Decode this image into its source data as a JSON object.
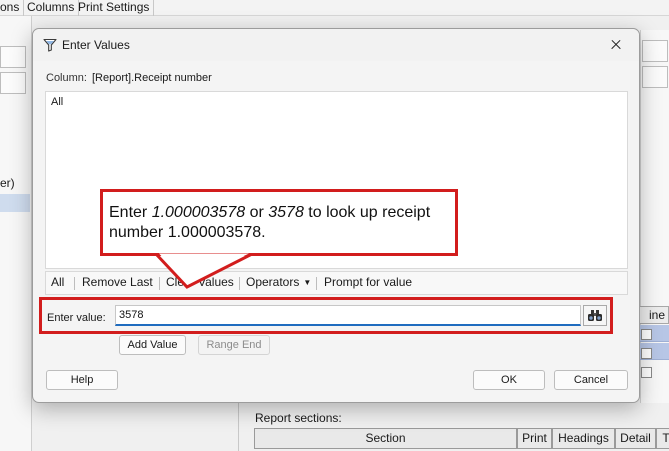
{
  "background": {
    "menu": [
      "ons",
      "Columns",
      "Print Settings"
    ],
    "left_panel_text": "er)",
    "line_header": "ine",
    "report_sections_label": "Report sections:",
    "table_headers": [
      "Section",
      "Print",
      "Headings",
      "Detail",
      "T"
    ]
  },
  "dialog": {
    "title": "Enter Values",
    "column_label": "Column:",
    "column_value": "[Report].Receipt number",
    "list_items": [
      "All"
    ],
    "toolbar": {
      "all": "All",
      "remove_last": "Remove Last",
      "clear_values": "Clear Values",
      "operators": "Operators",
      "prompt": "Prompt for value"
    },
    "enter_value_label": "Enter value:",
    "enter_value": "3578",
    "add_value": "Add Value",
    "range_end": "Range End",
    "help": "Help",
    "ok": "OK",
    "cancel": "Cancel"
  },
  "callout": {
    "text_1": "Enter ",
    "text_2": "1.000003578",
    "text_3": " or ",
    "text_4": "3578",
    "text_5": " to look up receipt number 1.000003578."
  },
  "colors": {
    "annotation_red": "#d21d1d",
    "focus_blue": "#1f6cbf",
    "selection_blue": "#b7c6e6"
  },
  "icons": {
    "title": "filter-icon",
    "close": "close-icon",
    "lookup": "binoculars-icon",
    "dropdown": "caret-down-icon"
  }
}
